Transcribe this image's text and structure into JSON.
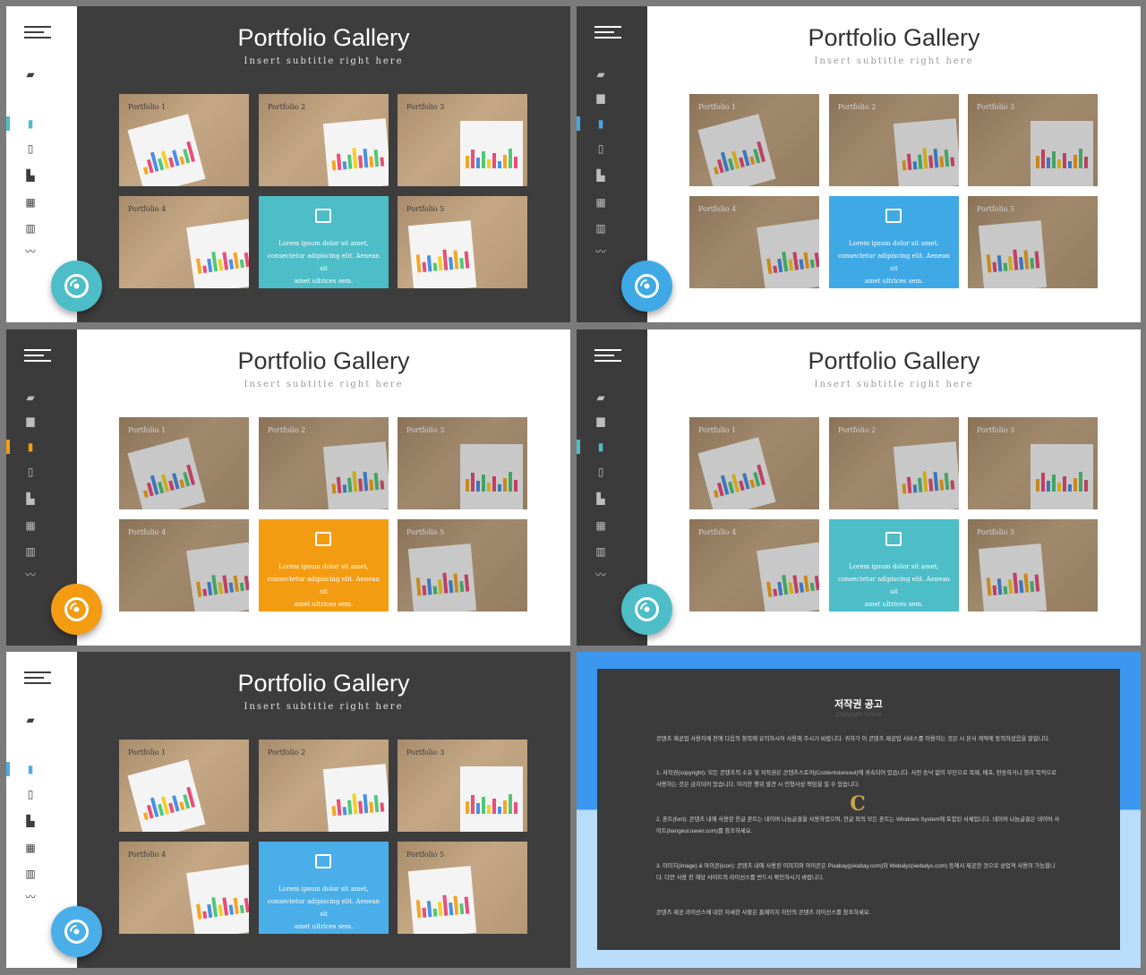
{
  "gallery": {
    "title": "Portfolio Gallery",
    "subtitle": "Insert subtitle right here",
    "tiles": [
      "Portfolio 1",
      "Portfolio 2",
      "Portfolio 3",
      "Portfolio 4",
      "Portfolio 5"
    ],
    "feature_text_1": "Lorem ipsum dolor sit amet,",
    "feature_text_2": "consectetur adipiscing elit. Aenean sit",
    "feature_text_3": "amet ultrices sem."
  },
  "nav_icons": [
    "home-icon",
    "users-icon",
    "book-icon",
    "mobile-icon",
    "thumbs-up-icon",
    "grid-icon",
    "bar-chart-icon",
    "line-chart-icon"
  ],
  "slides": [
    {
      "theme": "dark",
      "accent": "#4dbdc8"
    },
    {
      "theme": "light",
      "accent": "#3fa9e6"
    },
    {
      "theme": "light",
      "accent": "#f39c12"
    },
    {
      "theme": "light",
      "accent": "#4dbdc8"
    },
    {
      "theme": "dark",
      "accent": "#4aaee8"
    }
  ],
  "notice": {
    "title": "저작권 공고",
    "subtitle": "Copyright Notice",
    "intro": "콘텐츠 제공업 사용자께 전에 다음의 항목에 유의하시어 사용해 주시기 바랍니다. 귀하가 이 콘텐츠 제공업 서비스를 이용하는 것은 시 본서 계약에 동의하셨음을 말합니다.",
    "p1": "1. 저작권(copyright): 모든 콘텐츠의 소유 및 저작권은 콘텐츠스토어(Contentstoreout)에 귀속되어 있습니다. 사전 승낙 없이 무단으로 복제, 배포, 전송하거나 영리 목적으로 사용하는 것은 금지되어 있습니다. 이러한 행위 발견 시 민형사상 책임을 질 수 있습니다.",
    "p2": "2. 폰트(font): 콘텐츠 내에 사용된 한글 폰트는 네이버 나눔글꼴을 사용하였으며, 한글 외의 모든 폰트는 Windows System에 포함된 서체입니다. 네이버 나눔글꼴은 네이버 사이트(hangeul.naver.com)를 참조하세요.",
    "p3": "3. 이미지(image) & 아이콘(icon): 콘텐츠 내에 사용된 이미지와 아이콘은 Pixabay(pixabay.com)와 Webalys(webalys.com) 등에서 제공한 것으로 상업적 사용이 가능합니다. 다만 사용 전 해당 사이트의 라이선스를 반드시 확인하시기 바랍니다.",
    "outro": "콘텐츠 제공 라이선스에 대한 자세한 사항은 홈페이지 하단의 콘텐츠 라이선스를 참조하세요.",
    "logo_letter": "C"
  }
}
